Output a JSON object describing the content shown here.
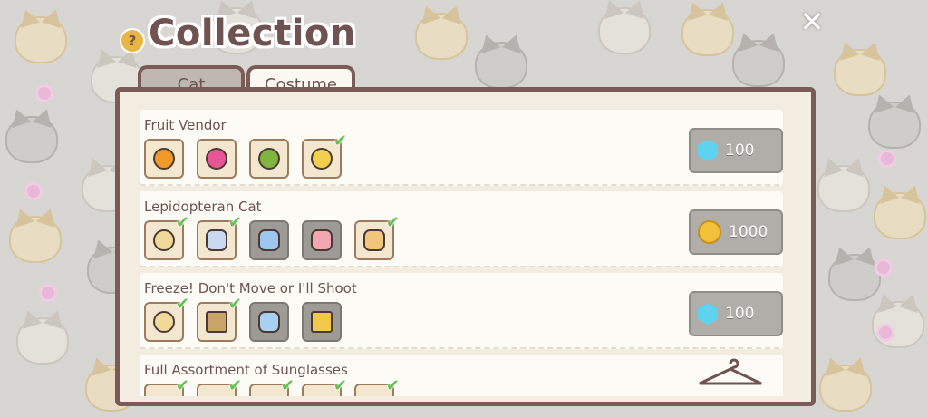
{
  "header": {
    "title": "Collection",
    "help_label": "?",
    "close_label": "✕"
  },
  "tabs": [
    {
      "label": "Cat",
      "selected": false
    },
    {
      "label": "Costume",
      "selected": true
    }
  ],
  "rows": [
    {
      "name": "Fruit Vendor",
      "currency": "gem-icon",
      "price": "100",
      "items": [
        {
          "icon": "orange-slice-icon",
          "color": "#f09a2a",
          "owned": true,
          "checked": false
        },
        {
          "icon": "grapefruit-slice-icon",
          "color": "#e85597",
          "owned": true,
          "checked": false
        },
        {
          "icon": "lime-slice-icon",
          "color": "#7fb53f",
          "owned": true,
          "checked": false
        },
        {
          "icon": "lemon-slice-icon",
          "color": "#f1d04d",
          "owned": true,
          "checked": true
        }
      ]
    },
    {
      "name": "Lepidopteran Cat",
      "currency": "coin-icon",
      "price": "1000",
      "items": [
        {
          "icon": "cocoon-icon",
          "color": "#f1d99a",
          "owned": true,
          "checked": true
        },
        {
          "icon": "yellow-antenna-wing-icon",
          "color": "#c9d9f0",
          "owned": true,
          "checked": true
        },
        {
          "icon": "blue-antenna-wing-icon",
          "color": "#9ec7ee",
          "owned": false,
          "checked": false
        },
        {
          "icon": "pink-antenna-wing-icon",
          "color": "#f2a8b3",
          "owned": false,
          "checked": false
        },
        {
          "icon": "orange-antenna-wing-icon",
          "color": "#f1c57c",
          "owned": true,
          "checked": true
        }
      ]
    },
    {
      "name": "Freeze! Don't Move or I'll Shoot",
      "currency": "gem-icon",
      "price": "100",
      "items": [
        {
          "icon": "hood-icon",
          "color": "#f1d99a",
          "owned": true,
          "checked": true
        },
        {
          "icon": "box-icon",
          "color": "#c9a468",
          "owned": true,
          "checked": true
        },
        {
          "icon": "blue-ribbon-icon",
          "color": "#a8d0f0",
          "owned": false,
          "checked": false
        },
        {
          "icon": "bee-box-icon",
          "color": "#f1c84a",
          "owned": false,
          "checked": false
        }
      ]
    },
    {
      "name": "Full Assortment of Sunglasses",
      "currency": "hanger-icon",
      "price": "",
      "items": [
        {
          "icon": "sunglasses-icon",
          "color": "#f3e7cf",
          "owned": true,
          "checked": true
        },
        {
          "icon": "sunglasses-icon",
          "color": "#f3e7cf",
          "owned": true,
          "checked": true
        },
        {
          "icon": "sunglasses-icon",
          "color": "#f3e7cf",
          "owned": true,
          "checked": true
        },
        {
          "icon": "sunglasses-icon",
          "color": "#f3e7cf",
          "owned": true,
          "checked": true
        },
        {
          "icon": "sunglasses-icon",
          "color": "#f3e7cf",
          "owned": true,
          "checked": true
        }
      ]
    }
  ]
}
